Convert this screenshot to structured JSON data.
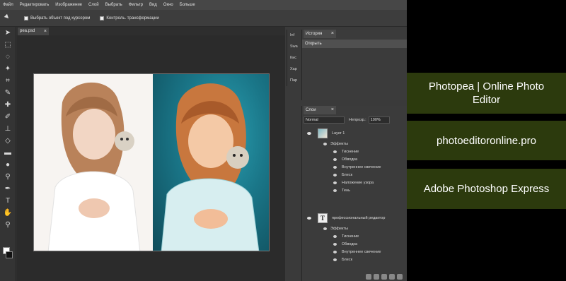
{
  "menu": [
    "Файл",
    "Редактировать",
    "Изображение",
    "Слой",
    "Выбрать",
    "Фильтр",
    "Вид",
    "Окно",
    "Больше"
  ],
  "options": {
    "auto_select_label": "Выбрать объект под курсором",
    "transform_controls_label": "Контроль. трансформации"
  },
  "document": {
    "tab_title": "pea.psd",
    "close": "×"
  },
  "side_strip": [
    "Inf",
    "Swa",
    "Кис",
    "Хар",
    "Пар"
  ],
  "history": {
    "tab_label": "История",
    "close": "×",
    "items": [
      "Открыть"
    ]
  },
  "layers": {
    "tab_label": "Слои",
    "close": "×",
    "blend_mode": "Normal",
    "opacity_label": "Непрозр.:",
    "opacity_value": "100%",
    "rows": [
      {
        "kind": "layer",
        "name": "Layer 1"
      },
      {
        "kind": "group",
        "name": "Эффекты"
      },
      {
        "kind": "effect",
        "name": "Тиснение"
      },
      {
        "kind": "effect",
        "name": "Обводка"
      },
      {
        "kind": "effect",
        "name": "Внутреннее свечение"
      },
      {
        "kind": "effect",
        "name": "Блеск"
      },
      {
        "kind": "effect",
        "name": "Наложение узора"
      },
      {
        "kind": "effect",
        "name": "Тень"
      },
      {
        "kind": "text-layer",
        "name": "профессиональный редактор"
      },
      {
        "kind": "group",
        "name": "Эффекты"
      },
      {
        "kind": "effect",
        "name": "Тиснение"
      },
      {
        "kind": "effect",
        "name": "Обводка"
      },
      {
        "kind": "effect",
        "name": "Внутреннее свечение"
      },
      {
        "kind": "effect",
        "name": "Блеск"
      }
    ]
  },
  "info_boxes": [
    "Photopea | Online Photo Editor",
    "photoeditoronline.pro",
    "Adobe Photoshop Express"
  ],
  "colors": {
    "info_bg": "#2c3a0d",
    "panel_bg": "#3b3b3b",
    "canvas_teal": "#1a7688"
  },
  "icons": [
    "move-tool-icon",
    "marquee-tool-icon",
    "lasso-tool-icon",
    "magic-wand-icon",
    "crop-tool-icon",
    "eyedropper-icon",
    "healing-brush-icon",
    "brush-icon",
    "clone-stamp-icon",
    "eraser-icon",
    "gradient-icon",
    "blur-icon",
    "dodge-icon",
    "pen-icon",
    "type-tool-icon",
    "hand-tool-icon",
    "zoom-tool-icon"
  ]
}
